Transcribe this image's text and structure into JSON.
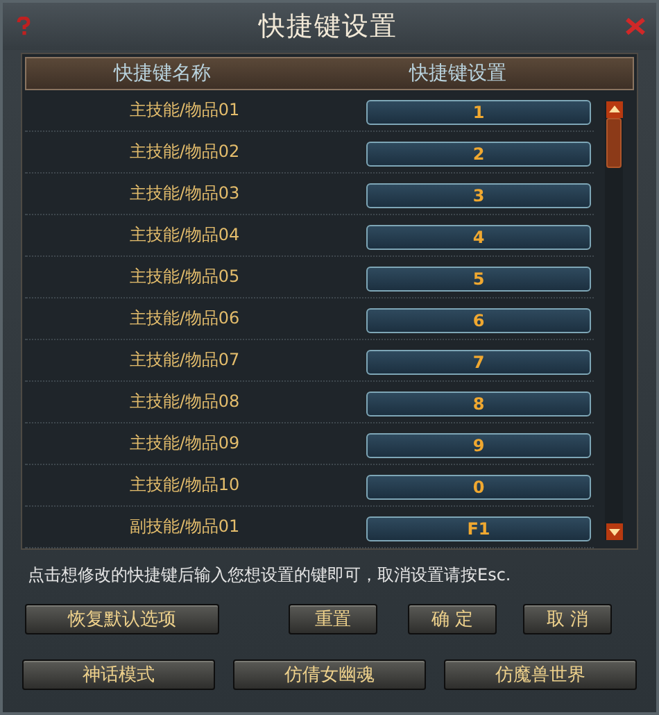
{
  "window": {
    "title": "快捷键设置"
  },
  "table": {
    "columns": [
      "快捷键名称",
      "快捷键设置"
    ],
    "rows": [
      {
        "name": "主技能/物品01",
        "key": "1"
      },
      {
        "name": "主技能/物品02",
        "key": "2"
      },
      {
        "name": "主技能/物品03",
        "key": "3"
      },
      {
        "name": "主技能/物品04",
        "key": "4"
      },
      {
        "name": "主技能/物品05",
        "key": "5"
      },
      {
        "name": "主技能/物品06",
        "key": "6"
      },
      {
        "name": "主技能/物品07",
        "key": "7"
      },
      {
        "name": "主技能/物品08",
        "key": "8"
      },
      {
        "name": "主技能/物品09",
        "key": "9"
      },
      {
        "name": "主技能/物品10",
        "key": "0"
      },
      {
        "name": "副技能/物品01",
        "key": "F1"
      }
    ]
  },
  "hint": "点击想修改的快捷键后输入您想设置的键即可，取消设置请按Esc.",
  "actions": [
    "恢复默认选项",
    "重置",
    "确 定",
    "取 消"
  ],
  "presets": [
    "神话模式",
    "仿倩女幽魂",
    "仿魔兽世界"
  ]
}
